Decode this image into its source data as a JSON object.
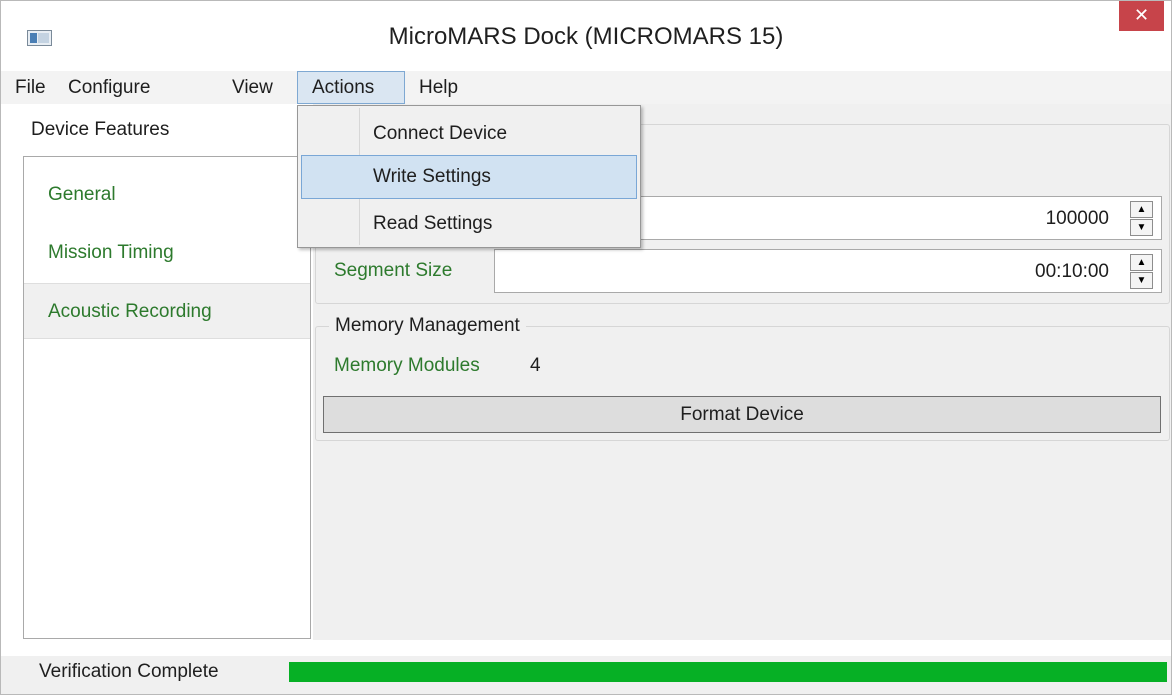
{
  "window": {
    "title": "MicroMARS Dock (MICROMARS 15)",
    "close_label": "✕"
  },
  "menubar": {
    "items": [
      {
        "label": "File"
      },
      {
        "label": "Configure"
      },
      {
        "label": "View"
      },
      {
        "label": "Actions",
        "open": true
      },
      {
        "label": "Help"
      }
    ]
  },
  "actions_menu": {
    "items": [
      {
        "label": "Connect Device"
      },
      {
        "label": "Write Settings",
        "highlighted": true
      },
      {
        "label": "Read Settings"
      }
    ]
  },
  "sidebar": {
    "header": "Device Features",
    "items": [
      {
        "label": "General"
      },
      {
        "label": "Mission Timing"
      },
      {
        "label": "Acoustic Recording",
        "selected": true
      }
    ]
  },
  "acoustic": {
    "sample_value": "100000",
    "segment_label": "Segment Size",
    "segment_value": "00:10:00"
  },
  "memory": {
    "group_title": "Memory Management",
    "modules_label": "Memory Modules",
    "modules_value": "4",
    "format_button": "Format Device"
  },
  "status": {
    "text": "Verification Complete",
    "progress": 1.0,
    "progress_color": "#06b025"
  },
  "colors": {
    "label_green": "#2d7a2d",
    "close_red": "#c7444a",
    "menu_highlight": "#d1e2f2"
  }
}
